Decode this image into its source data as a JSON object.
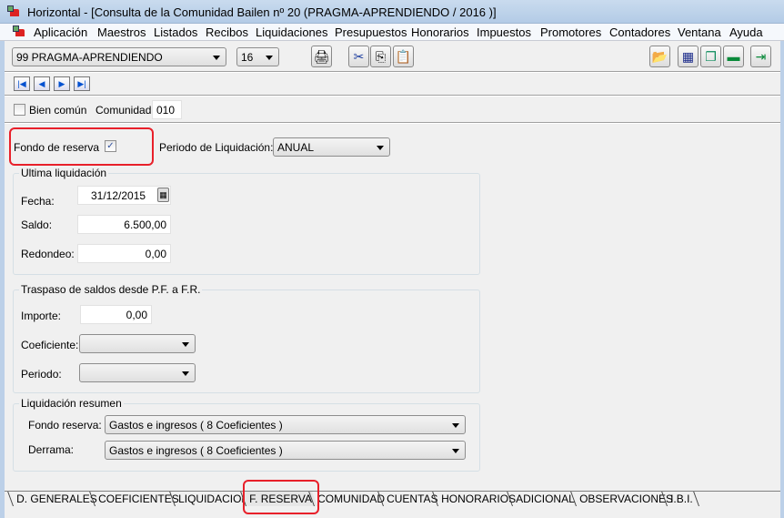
{
  "window": {
    "title": "Horizontal - [Consulta de la Comunidad Bailen nº 20 (PRAGMA-APRENDIENDO / 2016 )]"
  },
  "menu": [
    "Aplicación",
    "Maestros",
    "Listados",
    "Recibos",
    "Liquidaciones",
    "Presupuestos",
    "Honorarios",
    "Impuestos",
    "Promotores",
    "Contadores",
    "Ventana",
    "Ayuda"
  ],
  "toolbar": {
    "company": "99  PRAGMA-APRENDIENDO",
    "year": "16"
  },
  "form": {
    "bien_comun_label": "Bien común",
    "bien_comun_checked": false,
    "comunidad_label": "Comunidad:",
    "comunidad_value": "010",
    "fondo_label": "Fondo de reserva",
    "fondo_checked": true,
    "periodo_label": "Periodo de Liquidación:",
    "periodo_value": "ANUAL",
    "ultima": {
      "title": "Ultima liquidación",
      "fecha_label": "Fecha:",
      "fecha": "31/12/2015",
      "saldo_label": "Saldo:",
      "saldo": "6.500,00",
      "redondeo_label": "Redondeo:",
      "redondeo": "0,00"
    },
    "traspaso": {
      "title": "Traspaso de saldos desde P.F. a F.R.",
      "importe_label": "Importe:",
      "importe": "0,00",
      "coef_label": "Coeficiente:",
      "coef": "",
      "periodo_label": "Periodo:",
      "periodo": ""
    },
    "resumen": {
      "title": "Liquidación resumen",
      "fondo_label": "Fondo reserva:",
      "fondo": "Gastos e ingresos ( 8 Coeficientes )",
      "derrama_label": "Derrama:",
      "derrama": "Gastos e ingresos ( 8 Coeficientes )"
    }
  },
  "tabs": [
    "D. GENERALES",
    "COEFICIENTES",
    "LIQUIDACION",
    "F. RESERVA",
    "COMUNIDAD",
    "CUENTAS",
    "HONORARIOS",
    "ADICIONAL",
    "OBSERVACIONES",
    "I.B.I."
  ],
  "active_tab": "F. RESERVA",
  "colors": {
    "highlight": "#e8202a"
  }
}
